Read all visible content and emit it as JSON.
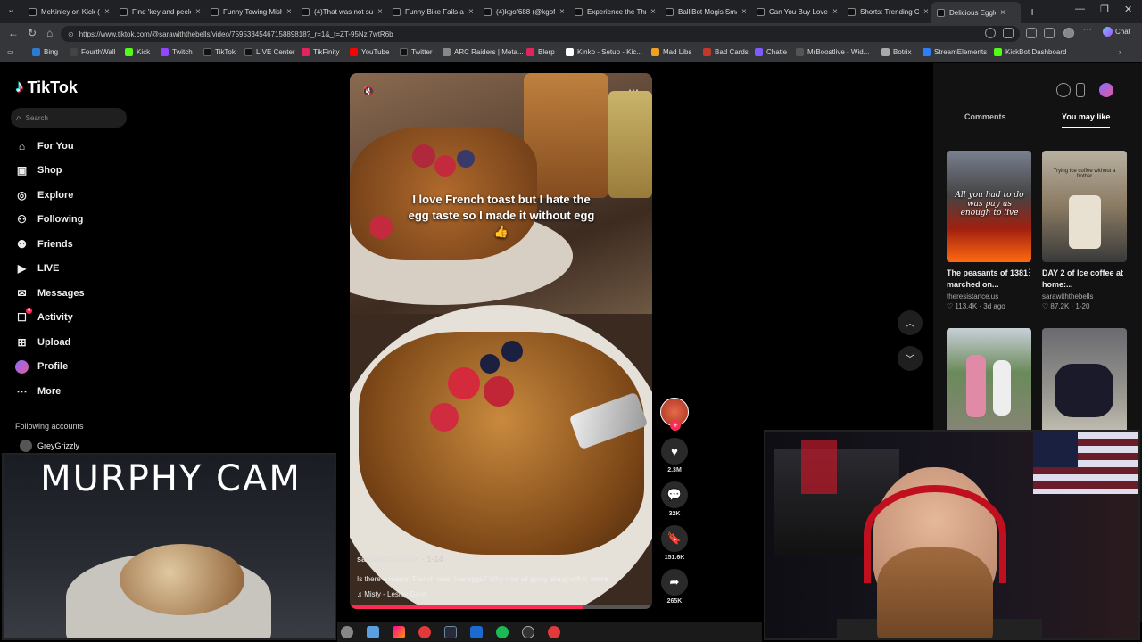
{
  "browser": {
    "tabs": [
      {
        "title": "McKinley on Kick (@"
      },
      {
        "title": "Find 'key and peele"
      },
      {
        "title": "Funny Towing Mish"
      },
      {
        "title": "(4)That was not sup"
      },
      {
        "title": "Funny Bike Fails and"
      },
      {
        "title": "(4)kgof688 (@kgofi"
      },
      {
        "title": "Experience the Thril"
      },
      {
        "title": "BalliBot Mogis Sma"
      },
      {
        "title": "Can You Buy Love?"
      },
      {
        "title": "Shorts: Trending Co"
      },
      {
        "title": "Delicious Eggle"
      }
    ],
    "url": "https://www.tiktok.com/@sarawiththebells/video/7595334546715889818?_r=1&_t=ZT-95Nzl7wtR6b",
    "chat_label": "Chat",
    "bookmarks": [
      {
        "label": "Bing",
        "color": "#2b7cd3"
      },
      {
        "label": "FourthWall",
        "color": "#444"
      },
      {
        "label": "Kick",
        "color": "#53fc18"
      },
      {
        "label": "Twitch",
        "color": "#9146ff"
      },
      {
        "label": "TikTok",
        "color": "#111"
      },
      {
        "label": "LIVE Center",
        "color": "#111"
      },
      {
        "label": "TikFinity",
        "color": "#e0245e"
      },
      {
        "label": "YouTube",
        "color": "#ff0000"
      },
      {
        "label": "Twitter",
        "color": "#111"
      },
      {
        "label": "ARC Raiders | Meta...",
        "color": "#888"
      },
      {
        "label": "Blerp",
        "color": "#e0245e"
      },
      {
        "label": "Kinko - Setup - Kic...",
        "color": "#fff"
      },
      {
        "label": "Mad Libs",
        "color": "#f0a020"
      },
      {
        "label": "Bad Cards",
        "color": "#c0392b"
      },
      {
        "label": "Chatle",
        "color": "#7c5cff"
      },
      {
        "label": "MrBoostlive - Wid...",
        "color": "#555"
      },
      {
        "label": "Botrix",
        "color": "#aaa"
      },
      {
        "label": "StreamElements",
        "color": "#2d7ff9"
      },
      {
        "label": "KickBot Dashboard",
        "color": "#53fc18"
      }
    ]
  },
  "tiktok": {
    "brand": "TikTok",
    "search_placeholder": "Search",
    "nav": [
      {
        "label": "For You",
        "icon": "home-icon"
      },
      {
        "label": "Shop",
        "icon": "shop-icon"
      },
      {
        "label": "Explore",
        "icon": "compass-icon"
      },
      {
        "label": "Following",
        "icon": "following-icon"
      },
      {
        "label": "Friends",
        "icon": "friends-icon"
      },
      {
        "label": "LIVE",
        "icon": "live-icon"
      },
      {
        "label": "Messages",
        "icon": "messages-icon"
      },
      {
        "label": "Activity",
        "icon": "activity-icon",
        "badge": "4"
      },
      {
        "label": "Upload",
        "icon": "upload-icon"
      },
      {
        "label": "Profile",
        "icon": "profile-icon"
      },
      {
        "label": "More",
        "icon": "more-icon"
      }
    ],
    "following_heading": "Following accounts",
    "following_first": "GreyGrizzly",
    "video": {
      "caption": "I love French toast but I hate the egg taste so I made it without egg 👍",
      "username": "sarawiththebells",
      "date": "· 1-14",
      "description": "Is there a reason French toast has eggs? Why r we all going along with it",
      "more": "more",
      "music": "Misty - Lesley Gore",
      "progress": 0.77
    },
    "actions": {
      "likes": "2.3M",
      "comments": "32K",
      "saves": "151.6K",
      "shares": "265K"
    },
    "right_panel": {
      "tab_comments": "Comments",
      "tab_you_may_like": "You may like",
      "cards": [
        {
          "title": "The peasants of 1381 marched on...",
          "author": "theresistance.us",
          "stats": "♡ 113.4K · 3d ago",
          "overlay": "All you had to do was pay us enough to live"
        },
        {
          "title": "DAY 2 of Ice coffee at home:...",
          "author": "sarawiththebells",
          "stats": "♡ 87.2K · 1-20",
          "overlay": "Trying Ice coffee without a frother"
        },
        {
          "title": "",
          "author": "",
          "stats": "",
          "overlay": ""
        },
        {
          "title": "",
          "author": "",
          "stats": "",
          "overlay": ""
        }
      ]
    }
  },
  "overlays": {
    "murphy_cam_title": "MURPHY CAM"
  }
}
